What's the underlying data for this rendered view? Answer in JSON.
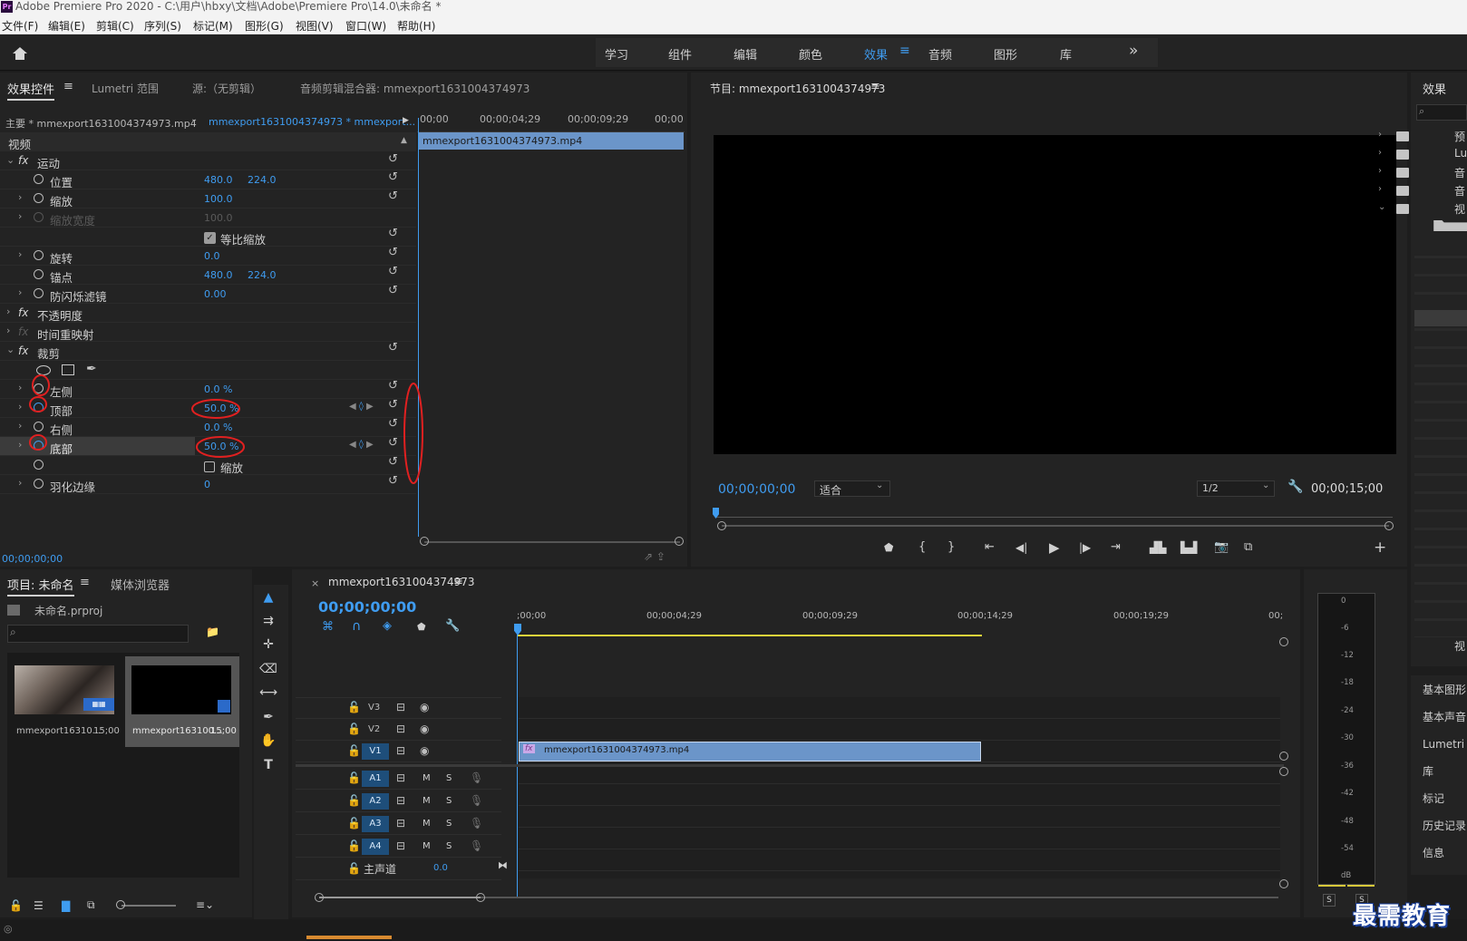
{
  "title_bar": {
    "logo": "Pr",
    "title": "Adobe Premiere Pro 2020 - C:\\用户\\hbxy\\文档\\Adobe\\Premiere Pro\\14.0\\未命名 *"
  },
  "menu": [
    "文件(F)",
    "编辑(E)",
    "剪辑(C)",
    "序列(S)",
    "标记(M)",
    "图形(G)",
    "视图(V)",
    "窗口(W)",
    "帮助(H)"
  ],
  "workspaces": {
    "items": [
      "学习",
      "组件",
      "编辑",
      "颜色",
      "效果",
      "音频",
      "图形",
      "库"
    ],
    "active": "效果",
    "more": "»"
  },
  "source_panel": {
    "tabs": [
      "效果控件",
      "Lumetri 范围",
      "源:（无剪辑）",
      "音频剪辑混合器: mmexport1631004374973"
    ],
    "master_clip": "主要 * mmexport1631004374973.mp4",
    "sequence_clip": "mmexport1631004374973 * mmexport...",
    "ruler_labels": [
      "00;00",
      "00;00;04;29",
      "00;00;09;29",
      "00;00"
    ],
    "clip_bar": "mmexport1631004374973.mp4",
    "video_header": "视频",
    "motion": "运动",
    "position_label": "位置",
    "position_x": "480.0",
    "position_y": "224.0",
    "scale_label": "缩放",
    "scale_value": "100.0",
    "scale_width_label": "缩放宽度",
    "scale_width_value": "100.0",
    "uniform_scale": "等比缩放",
    "rotation_label": "旋转",
    "rotation_value": "0.0",
    "anchor_label": "锚点",
    "anchor_x": "480.0",
    "anchor_y": "224.0",
    "flicker_label": "防闪烁滤镜",
    "flicker_value": "0.00",
    "opacity": "不透明度",
    "time_remap": "时间重映射",
    "crop": "裁剪",
    "crop_left_label": "左侧",
    "crop_left_value": "0.0 %",
    "crop_top_label": "顶部",
    "crop_top_value": "50.0 %",
    "crop_right_label": "右侧",
    "crop_right_value": "0.0 %",
    "crop_bottom_label": "底部",
    "crop_bottom_value": "50.0 %",
    "crop_zoom": "缩放",
    "feather_label": "羽化边缘",
    "feather_value": "0",
    "timecode": "00;00;00;00"
  },
  "program_monitor": {
    "title": "节目: mmexport1631004374973",
    "timecode": "00;00;00;00",
    "fit": "适合",
    "resolution": "1/2",
    "duration": "00;00;15;00"
  },
  "effects_panel": {
    "title": "效果",
    "items": [
      "预",
      "Lu",
      "音",
      "音",
      "视"
    ]
  },
  "side_panels": [
    "基本图形",
    "基本声音",
    "Lumetri 颜色",
    "库",
    "标记",
    "历史记录",
    "信息"
  ],
  "project_panel": {
    "tabs": [
      "项目: 未命名",
      "媒体浏览器"
    ],
    "file": "未命名.prproj",
    "items": [
      {
        "name": "mmexport16310...",
        "duration": "15;00"
      },
      {
        "name": "mmexport163100...",
        "duration": "15;00"
      }
    ]
  },
  "timeline": {
    "tab": "mmexport1631004374973",
    "timecode": "00;00;00;00",
    "ruler": [
      ";00;00",
      "00;00;04;29",
      "00;00;09;29",
      "00;00;14;29",
      "00;00;19;29",
      "00;"
    ],
    "video_tracks": [
      "V3",
      "V2",
      "V1"
    ],
    "audio_tracks": [
      "A1",
      "A2",
      "A3",
      "A4"
    ],
    "master_label": "主声道",
    "master_value": "0.0",
    "clip": "mmexport1631004374973.mp4",
    "mute": "M",
    "solo": "S"
  },
  "audio_meter": {
    "ticks": [
      "0",
      "-6",
      "-12",
      "-18",
      "-24",
      "-30",
      "-36",
      "-42",
      "-48",
      "-54",
      "dB"
    ],
    "solo": "S",
    "solo2": "S"
  },
  "watermark": "最需教育"
}
